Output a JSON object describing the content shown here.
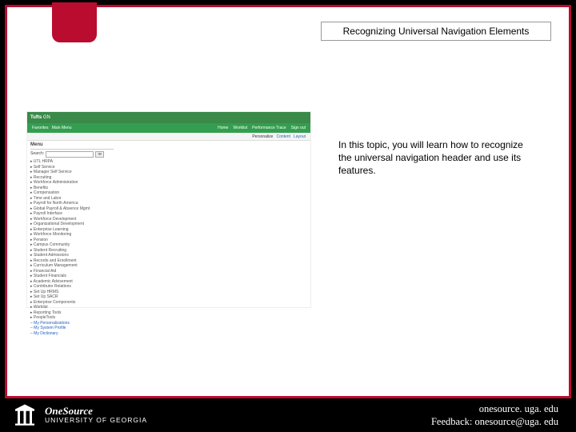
{
  "title": "Recognizing Universal Navigation Elements",
  "body_text": "In this topic, you will learn how to recognize the universal navigation header and use its features.",
  "screenshot": {
    "brand": "Tufts",
    "brand_sub": "GN",
    "topnav_left": [
      "Favorites",
      "Main Menu"
    ],
    "topnav_right": [
      "Home",
      "Worklist",
      "Performance Trace",
      "Sign out"
    ],
    "subnav": [
      "Personalize",
      "Content",
      "Layout"
    ],
    "menu_title": "Menu",
    "search_label": "Search:",
    "sidebar_items": [
      "UTL HRPA",
      "Self Service",
      "Manager Self Service",
      "Recruiting",
      "Workforce Administration",
      "Benefits",
      "Compensation",
      "Time and Labor",
      "Payroll for North America",
      "Global Payroll & Absence Mgmt",
      "Payroll Interface",
      "Workforce Development",
      "Organizational Development",
      "Enterprise Learning",
      "Workforce Monitoring",
      "Pension",
      "Campus Community",
      "Student Recruiting",
      "Student Admissions",
      "Records and Enrollment",
      "Curriculum Management",
      "Financial Aid",
      "Student Financials",
      "Academic Advisement",
      "Contributor Relations",
      "Set Up HRMS",
      "Set Up SACR",
      "Enterprise Components",
      "Worklist",
      "Reporting Tools",
      "PeopleTools"
    ],
    "sidebar_links": [
      "My Personalizations",
      "My System Profile",
      "My Dictionary"
    ]
  },
  "footer": {
    "brand_line1": "OneSource",
    "brand_line2": "UNIVERSITY OF GEORGIA",
    "url": "onesource. uga. edu",
    "feedback": "Feedback: onesource@uga. edu"
  }
}
